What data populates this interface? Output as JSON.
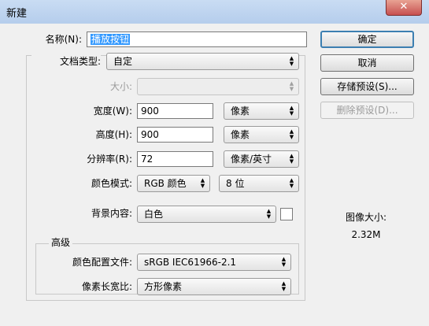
{
  "window": {
    "title": "新建",
    "close_glyph": "✕"
  },
  "form": {
    "name_label": "名称(N):",
    "name_value": "播放按钮",
    "preset_label": "文档类型:",
    "preset_value": "自定",
    "size_label": "大小:",
    "size_value": "",
    "width_label": "宽度(W):",
    "width_value": "900",
    "width_unit": "像素",
    "height_label": "高度(H):",
    "height_value": "900",
    "height_unit": "像素",
    "resolution_label": "分辨率(R):",
    "resolution_value": "72",
    "resolution_unit": "像素/英寸",
    "color_mode_label": "颜色模式:",
    "color_mode_value": "RGB 颜色",
    "bit_depth_value": "8 位",
    "background_label": "背景内容:",
    "background_value": "白色"
  },
  "advanced": {
    "title": "高级",
    "color_profile_label": "颜色配置文件:",
    "color_profile_value": "sRGB IEC61966-2.1",
    "pixel_aspect_label": "像素长宽比:",
    "pixel_aspect_value": "方形像素"
  },
  "buttons": {
    "ok": "确定",
    "cancel": "取消",
    "save_preset": "存储预设(S)...",
    "delete_preset": "删除预设(D)..."
  },
  "image_size": {
    "label": "图像大小:",
    "value": "2.32M"
  },
  "icons": {
    "dropdown_arrow": "▲▼"
  }
}
